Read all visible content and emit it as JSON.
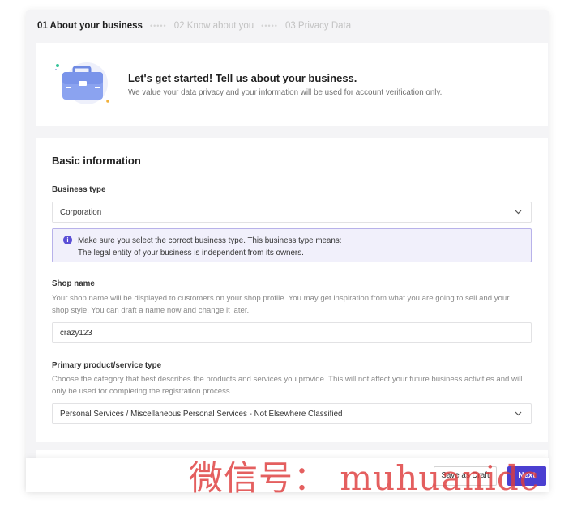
{
  "steps": [
    {
      "label": "01 About your business"
    },
    {
      "label": "02 Know about you"
    },
    {
      "label": "03 Privacy Data"
    }
  ],
  "intro": {
    "title": "Let's get started! Tell us about your business.",
    "subtitle": "We value your data privacy and your information will be used for account verification only."
  },
  "basic_info": {
    "title": "Basic information",
    "business_type": {
      "label": "Business type",
      "value": "Corporation",
      "info_line1": "Make sure you select the correct business type. This business type means:",
      "info_line2": "The legal entity of your business is independent from its owners."
    },
    "shop_name": {
      "label": "Shop name",
      "help": "Your shop name will be displayed to customers on your shop profile. You may get inspiration from what you are going to sell and your shop style. You can draft a name now and change it later.",
      "value": "crazy123"
    },
    "primary_type": {
      "label": "Primary product/service type",
      "help": "Choose the category that best describes the products and services you provide. This will not affect your future business activities and will only be used for completing the registration process.",
      "value": "Personal Services / Miscellaneous Personal Services - Not Elsewhere Classified"
    }
  },
  "footer": {
    "save_draft_label": "Save as Draft",
    "next_label": "Next"
  },
  "watermark": "微信号： muhuanidc",
  "colors": {
    "accent": "#4b3fd1",
    "info_bg": "#f1f0fb",
    "info_border": "#b8b2ea"
  },
  "icons": [
    "briefcase-illustration-icon",
    "info-icon",
    "chevron-down-icon"
  ]
}
